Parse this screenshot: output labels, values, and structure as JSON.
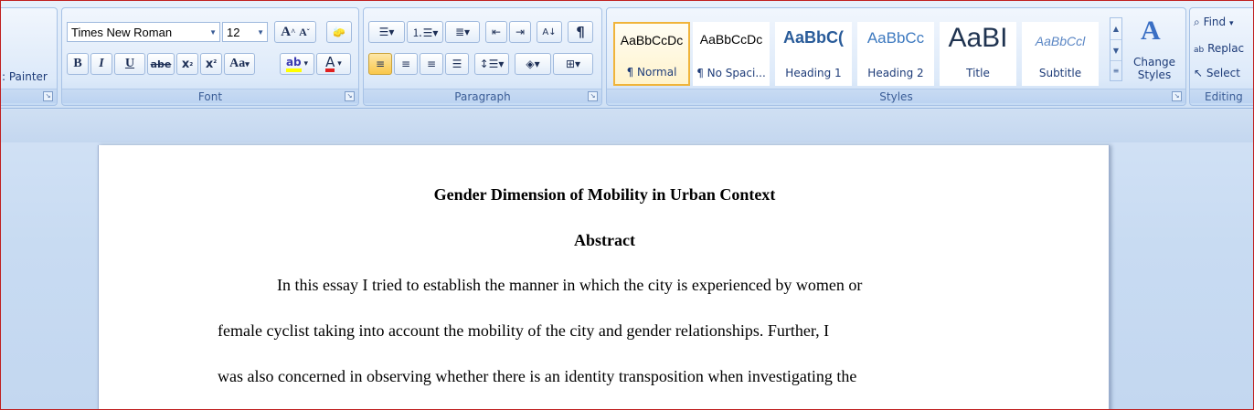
{
  "clipboard": {
    "format_painter_label": ": Painter"
  },
  "font_group": {
    "label": "Font",
    "font_name": "Times New Roman",
    "font_size": "12",
    "grow_label": "A",
    "shrink_label": "A",
    "bold": "B",
    "italic": "I",
    "underline": "U",
    "strike": "abe",
    "subscript": "x",
    "superscript": "x",
    "change_case": "Aa",
    "highlight": "ab",
    "font_color": "A"
  },
  "paragraph_group": {
    "label": "Paragraph",
    "pilcrow": "¶"
  },
  "styles_group": {
    "label": "Styles",
    "tiles": [
      {
        "sample": "AaBbCcDc",
        "name": "¶ Normal"
      },
      {
        "sample": "AaBbCcDc",
        "name": "¶ No Spaci..."
      },
      {
        "sample": "AaBbC(",
        "name": "Heading 1"
      },
      {
        "sample": "AaBbCc",
        "name": "Heading 2"
      },
      {
        "sample": "AaBI",
        "name": "Title"
      },
      {
        "sample": "AaBbCcl",
        "name": "Subtitle"
      }
    ],
    "change_styles": "Change Styles"
  },
  "editing_group": {
    "label": "Editing",
    "find": "Find",
    "replace": "Replac",
    "select": "Select"
  },
  "document": {
    "title": "Gender Dimension of Mobility in Urban Context",
    "abstract_heading": "Abstract",
    "lines": [
      "In this essay I tried to establish the manner in which the city is experienced by women or",
      "female cyclist taking into account the mobility of the city and gender relationships. Further, I",
      "was also concerned in observing whether there is an identity transposition when investigating the"
    ]
  },
  "colors": {
    "accent_selected": "#f0b43a",
    "ribbon_text": "#15428b",
    "highlight_yellow": "#ffff00",
    "font_red": "#e02020"
  }
}
